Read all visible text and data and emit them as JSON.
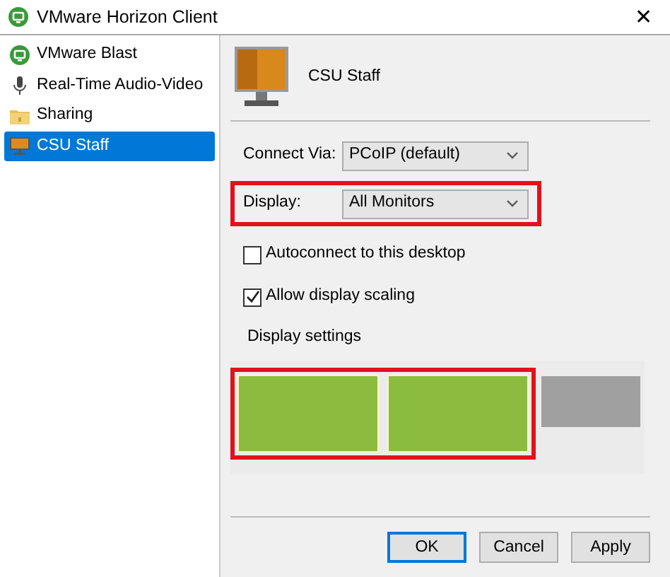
{
  "window": {
    "title": "VMware Horizon Client",
    "close": "✕"
  },
  "sidebar": {
    "items": [
      {
        "label": "VMware Blast",
        "kind": "blast",
        "selected": false
      },
      {
        "label": "Real-Time Audio-Video",
        "kind": "mic",
        "selected": false
      },
      {
        "label": "Sharing",
        "kind": "folder",
        "selected": false
      },
      {
        "label": "CSU Staff",
        "kind": "desktop",
        "selected": true
      }
    ]
  },
  "header": {
    "title": "CSU Staff"
  },
  "fields": [
    {
      "label": "Connect Via:",
      "value": "PCoIP (default)",
      "highlighted": false
    },
    {
      "label": "Display:",
      "value": "All Monitors",
      "highlighted": true
    }
  ],
  "checkboxes": [
    {
      "label": "Autoconnect to this desktop",
      "checked": false
    },
    {
      "label": "Allow display scaling",
      "checked": true
    }
  ],
  "display_settings": {
    "title": "Display settings",
    "monitors_highlighted": true,
    "monitors": [
      {
        "selected": true
      },
      {
        "selected": true
      },
      {
        "selected": false
      }
    ]
  },
  "buttons": [
    {
      "label": "OK",
      "default": true
    },
    {
      "label": "Cancel",
      "default": false
    },
    {
      "label": "Apply",
      "default": false
    }
  ]
}
